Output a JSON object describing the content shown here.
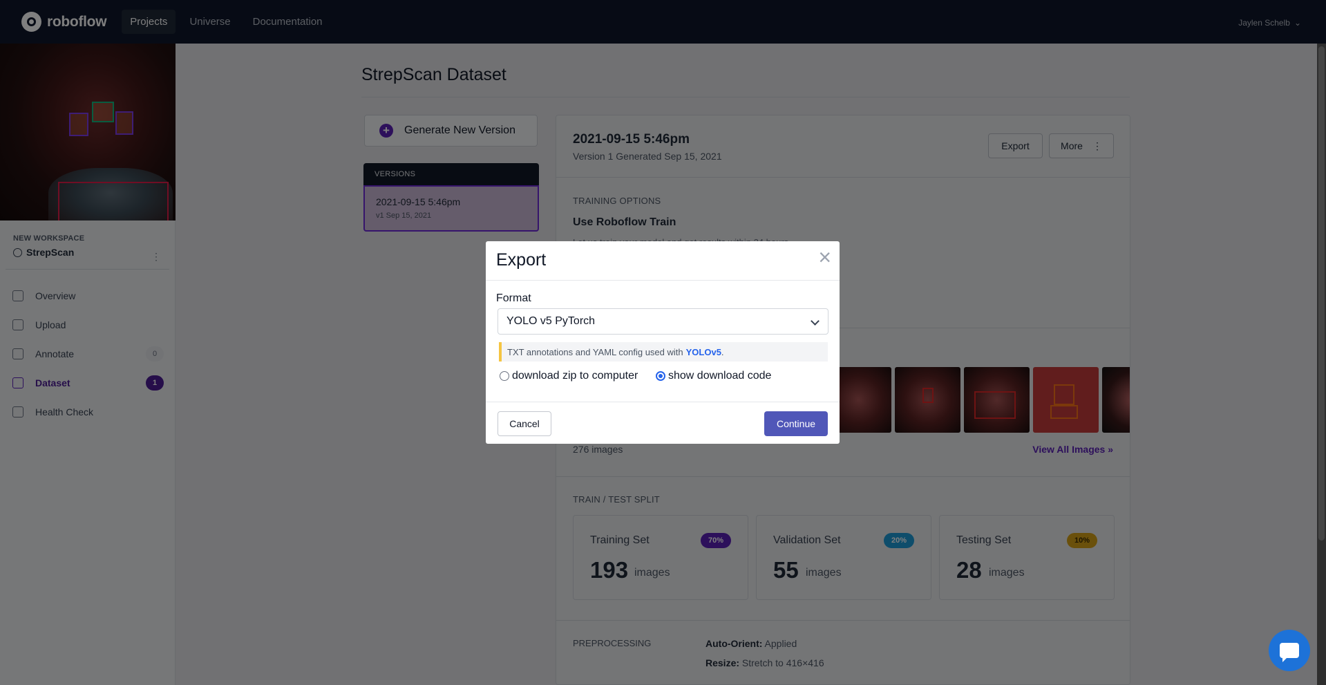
{
  "nav": {
    "logo_text": "roboflow",
    "links": [
      "Projects",
      "Universe",
      "Documentation"
    ],
    "user": "Jaylen Schelb"
  },
  "sidebar": {
    "workspace_label": "NEW WORKSPACE",
    "workspace_name": "StrepScan",
    "items": [
      {
        "label": "Overview"
      },
      {
        "label": "Upload"
      },
      {
        "label": "Annotate",
        "badge": "0"
      },
      {
        "label": "Dataset",
        "badge": "1"
      },
      {
        "label": "Health Check"
      }
    ]
  },
  "main": {
    "page_title": "StrepScan Dataset",
    "generate_button": "Generate New Version",
    "versions_header": "VERSIONS",
    "version_card": {
      "title": "2021-09-15 5:46pm",
      "sub": "v1 Sep 15, 2021"
    }
  },
  "panel": {
    "title": "2021-09-15 5:46pm",
    "subtitle": "Version 1 Generated Sep 15, 2021",
    "export_button": "Export",
    "more_button": "More",
    "training_options_label": "TRAINING OPTIONS",
    "train_title": "Use Roboflow Train",
    "train_desc": "Let us train your model and get results within 24 hours.",
    "images_count": "276 images",
    "view_all": "View All Images »",
    "split_label": "TRAIN / TEST SPLIT",
    "splits": [
      {
        "title": "Training Set",
        "pct": "70%",
        "num": "193",
        "unit": "images",
        "color": "#5b21b6"
      },
      {
        "title": "Validation Set",
        "pct": "20%",
        "num": "55",
        "unit": "images",
        "color": "#1d9bd7"
      },
      {
        "title": "Testing Set",
        "pct": "10%",
        "num": "28",
        "unit": "images",
        "color": "#d4a017"
      }
    ],
    "preprocessing_label": "PREPROCESSING",
    "pre_rows": [
      {
        "key": "Auto-Orient:",
        "value": " Applied"
      },
      {
        "key": "Resize:",
        "value": " Stretch to 416×416"
      }
    ]
  },
  "modal": {
    "title": "Export",
    "close": "×",
    "format_label": "Format",
    "format_value": "YOLO v5 PyTorch",
    "note_text": "TXT annotations and YAML config used with",
    "note_link": "YOLOv5",
    "note_end": ".",
    "radio_zip": "download zip to computer",
    "radio_code": "show download code",
    "selected_option": "show download code",
    "cancel": "Cancel",
    "continue": "Continue"
  },
  "colors": {
    "nav_bg": "#0f172a",
    "accent": "#5b21b6",
    "continue_btn": "#5057b8"
  }
}
